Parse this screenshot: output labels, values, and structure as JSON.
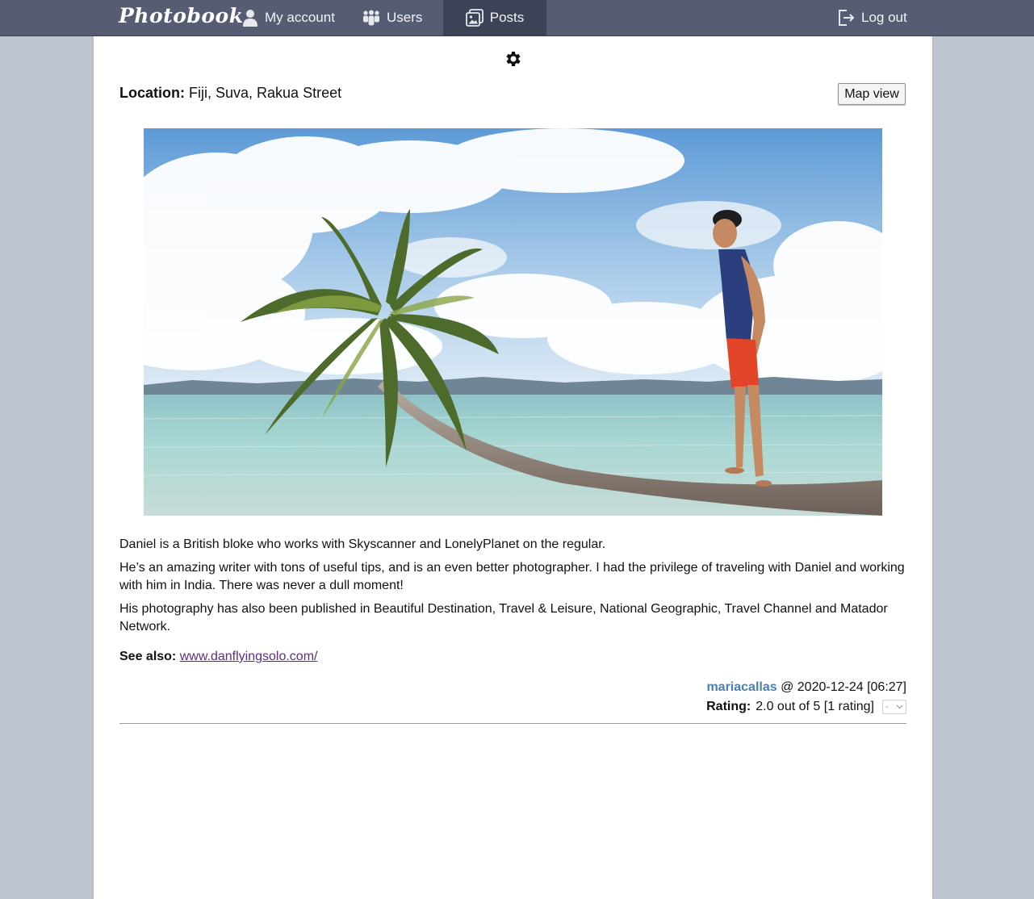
{
  "nav": {
    "brand": "Photobook",
    "my_account": "My account",
    "users": "Users",
    "posts": "Posts",
    "logout": "Log out"
  },
  "post": {
    "location_label": "Location:",
    "location_value": "Fiji, Suva, Rakua Street",
    "map_view_button": "Map view",
    "paragraphs": [
      "Daniel is a British bloke who works with Skyscanner and LonelyPlanet on the regular.",
      "He’s an amazing writer with tons of useful tips, and is an even better photographer. I had the privilege of traveling with Daniel and working with him in India. There was never a dull moment!",
      "His photography has also been published in Beautiful Destination, Travel & Leisure, National Geographic, Travel Channel and Matador Network."
    ],
    "see_also_label": "See also:",
    "see_also_link": "www.danflyingsolo.com/",
    "author": "mariacallas",
    "timestamp": "@ 2020-12-24 [06:27]",
    "rating_label": "Rating:",
    "rating_value": "2.0 out of 5 [1 rating]",
    "rating_select_value": "-"
  },
  "colors": {
    "navbar": "#565d72",
    "navbar_active": "#3d4356",
    "page_background": "#bfc5ce",
    "author_link": "#4a7fb3",
    "visited_link": "#5b2c86"
  },
  "icons": [
    "user-icon",
    "users-icon",
    "gallery-icon",
    "logout-icon",
    "gear-icon",
    "chevron-down-icon"
  ]
}
